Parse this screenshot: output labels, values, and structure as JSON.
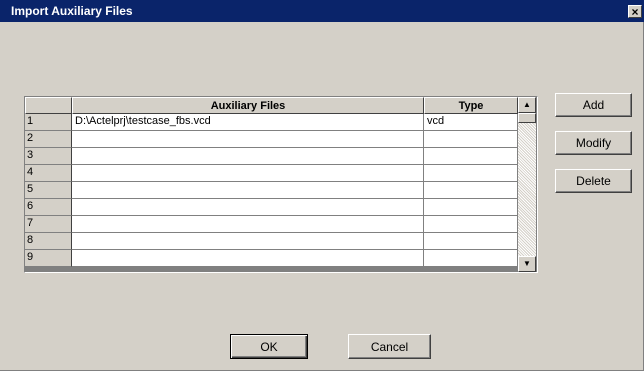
{
  "window": {
    "title": "Import Auxiliary Files",
    "close_glyph": "×"
  },
  "grid": {
    "columns": [
      "Auxiliary Files",
      "Type"
    ],
    "rows": [
      {
        "num": "1",
        "file": "D:\\Actelprj\\testcase_fbs.vcd",
        "type": "vcd"
      },
      {
        "num": "2",
        "file": "",
        "type": ""
      },
      {
        "num": "3",
        "file": "",
        "type": ""
      },
      {
        "num": "4",
        "file": "",
        "type": ""
      },
      {
        "num": "5",
        "file": "",
        "type": ""
      },
      {
        "num": "6",
        "file": "",
        "type": ""
      },
      {
        "num": "7",
        "file": "",
        "type": ""
      },
      {
        "num": "8",
        "file": "",
        "type": ""
      },
      {
        "num": "9",
        "file": "",
        "type": ""
      }
    ],
    "scroll_up_glyph": "▲",
    "scroll_down_glyph": "▼"
  },
  "side_buttons": {
    "add": "Add",
    "modify": "Modify",
    "delete": "Delete"
  },
  "footer": {
    "ok": "OK",
    "cancel": "Cancel"
  },
  "colors": {
    "title_bar": "#0a246a",
    "dialog_bg": "#d4d0c8"
  }
}
